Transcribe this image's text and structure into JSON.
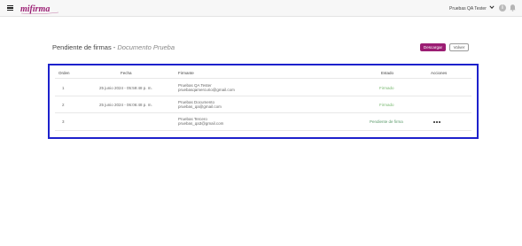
{
  "header": {
    "logo_text": "mifirma",
    "user_name": "Pruebas QA Tester",
    "colors": {
      "brand": "#9b1d73",
      "topbar_bg": "#f7f7f7"
    }
  },
  "page": {
    "title": "Pendiente de firmas",
    "separator": " - ",
    "document_name": "Documento Prueba"
  },
  "actions": {
    "download_label": "Descargar",
    "back_label": "Volver"
  },
  "table": {
    "columns": {
      "order": "Orden",
      "date": "Fecha",
      "signer": "Firmante",
      "status": "Estado",
      "actions": "Acciones"
    },
    "rows": [
      {
        "order": "1",
        "date": "25 junio 2024 - 05:59:48 p. m.",
        "signer_name": "Pruebas QA Tester",
        "signer_email": "pruebasqamercurio@gmail.com",
        "status": "Firmado",
        "status_type": "signed",
        "has_actions": false
      },
      {
        "order": "2",
        "date": "25 junio 2024 - 06:06:48 p. m.",
        "signer_name": "Pruebas Documento",
        "signer_email": "pruebas_qa@gmail.com",
        "status": "Firmado",
        "status_type": "signed",
        "has_actions": false
      },
      {
        "order": "3",
        "date": "",
        "signer_name": "Pruebas Tercero",
        "signer_email": "pruebas_qa3@gmail.com",
        "status": "Pendiente de firma",
        "status_type": "pending",
        "has_actions": true
      }
    ]
  }
}
